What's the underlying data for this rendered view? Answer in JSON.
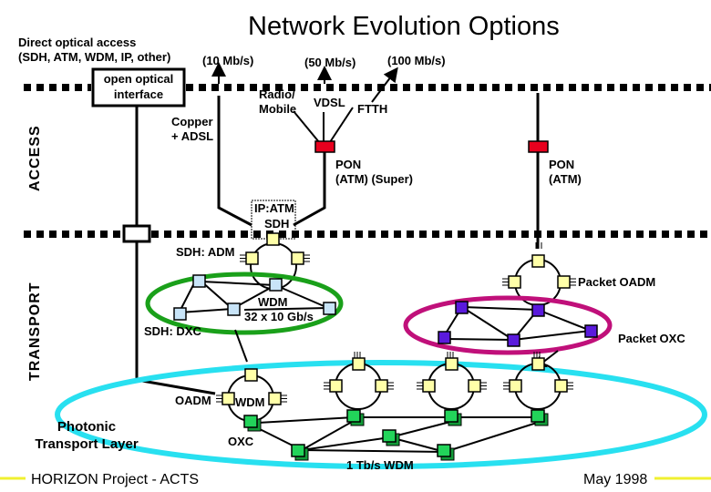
{
  "title": "Network Evolution Options",
  "layers": {
    "access": "ACCESS",
    "transport": "TRANSPORT"
  },
  "access": {
    "direct_optical_line1": "Direct optical access",
    "direct_optical_line2": "(SDH, ATM, WDM, IP, other)",
    "open_optical_line1": "open optical",
    "open_optical_line2": "interface",
    "rate_10": "(10 Mb/s)",
    "rate_50": "(50 Mb/s)",
    "rate_100": "(100 Mb/s)",
    "copper_line1": "Copper",
    "copper_line2": "+ ADSL",
    "radio_line1": "Radio/",
    "radio_line2": "Mobile",
    "vdsl": "VDSL",
    "ftth": "FTTH",
    "pon_super_line1": "PON",
    "pon_super_line2": "(ATM) (Super)",
    "pon_atm_line1": "PON",
    "pon_atm_line2": "(ATM)",
    "node_color": "#e8001e"
  },
  "transport": {
    "ip_atm": "IP:ATM",
    "sdh": "SDH",
    "sdh_adm": "SDH: ADM",
    "sdh_dxc": "SDH: DXC",
    "wdm_line1": "WDM",
    "wdm_line2": "32 x 10 Gb/s",
    "packet_oadm": "Packet OADM",
    "packet_oxc": "Packet OXC",
    "sdh_ellipse_color": "#1aa01a",
    "packet_ellipse_color": "#c0107a"
  },
  "photonic": {
    "layer_line1": "Photonic",
    "layer_line2": "Transport Layer",
    "oadm": "OADM",
    "wdm": "WDM",
    "oxc": "OXC",
    "tbps": "1 Tb/s WDM",
    "ellipse_color": "#28e0f0"
  },
  "footer": {
    "project": "HORIZON Project - ACTS",
    "date": "May 1998"
  }
}
